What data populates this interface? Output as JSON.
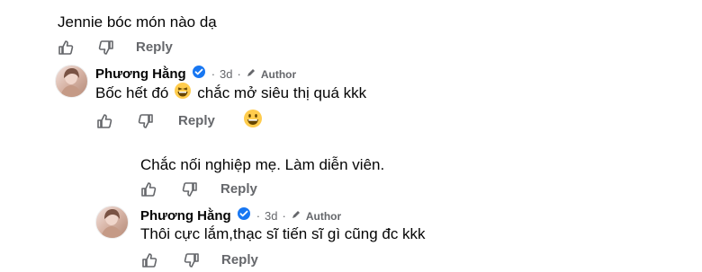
{
  "comments": [
    {
      "text": "Jennie bóc món nào dạ",
      "reply_label": "Reply"
    },
    {
      "author": "Phương Hằng",
      "time": "3d",
      "badge": "Author",
      "text_before_emoji": "Bốc hết đó",
      "emoji": "grinning-squinting-face",
      "text_after_emoji": "chắc mở siêu thị quá kkk",
      "reply_label": "Reply",
      "reaction_emoji": "grinning-face-with-big-eyes"
    },
    {
      "text": "Chắc nối nghiệp mẹ. Làm diễn viên.",
      "reply_label": "Reply"
    },
    {
      "author": "Phương Hằng",
      "time": "3d",
      "badge": "Author",
      "text": "Thôi cực lắm,thạc sĩ tiến sĩ gì cũng đc kkk",
      "reply_label": "Reply"
    }
  ],
  "colors": {
    "text": "#050505",
    "muted": "#65676b",
    "verified_blue": "#1877f2",
    "emoji_yellow": "#ffcc4d"
  }
}
